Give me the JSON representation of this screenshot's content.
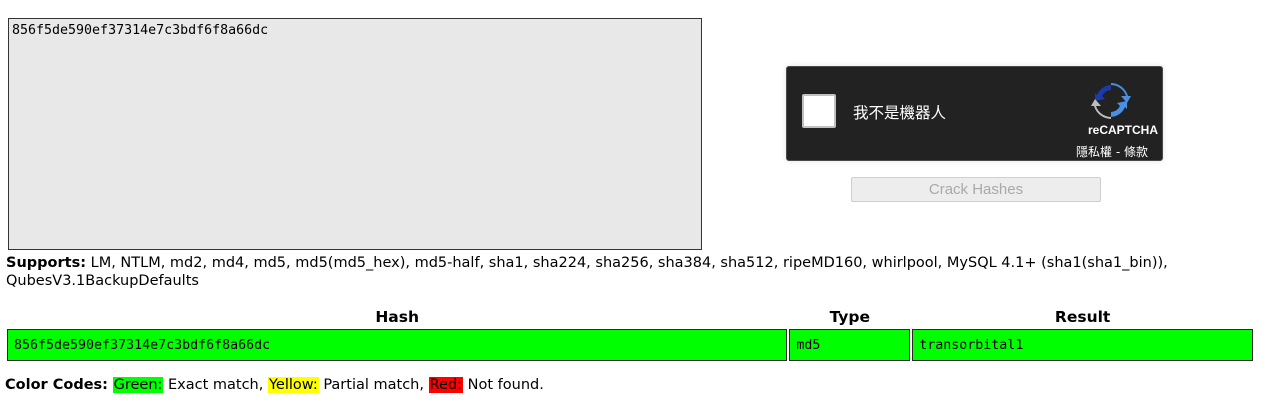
{
  "input": {
    "hash_text": "856f5de590ef37314e7c3bdf6f8a66dc"
  },
  "recaptcha": {
    "label": "我不是機器人",
    "brand": "reCAPTCHA",
    "privacy": "隱私權",
    "separator": " - ",
    "terms": "條款"
  },
  "crack_button": {
    "label": "Crack Hashes"
  },
  "supports": {
    "label": "Supports:",
    "text": " LM, NTLM, md2, md4, md5, md5(md5_hex), md5-half, sha1, sha224, sha256, sha384, sha512, ripeMD160, whirlpool, MySQL 4.1+ (sha1(sha1_bin)), QubesV3.1BackupDefaults"
  },
  "table": {
    "headers": [
      "Hash",
      "Type",
      "Result"
    ],
    "rows": [
      {
        "hash": "856f5de590ef37314e7c3bdf6f8a66dc",
        "type": "md5",
        "result": "transorbital1",
        "status_color": "#00ff00"
      }
    ]
  },
  "color_codes": {
    "label": "Color Codes:",
    "green": {
      "name": "Green:",
      "desc": " Exact match,",
      "color": "#00ff00"
    },
    "yellow": {
      "name": "Yellow:",
      "desc": " Partial match,",
      "color": "#ffff00"
    },
    "red": {
      "name": "Red:",
      "desc": " Not found.",
      "color": "#ff0000"
    }
  }
}
